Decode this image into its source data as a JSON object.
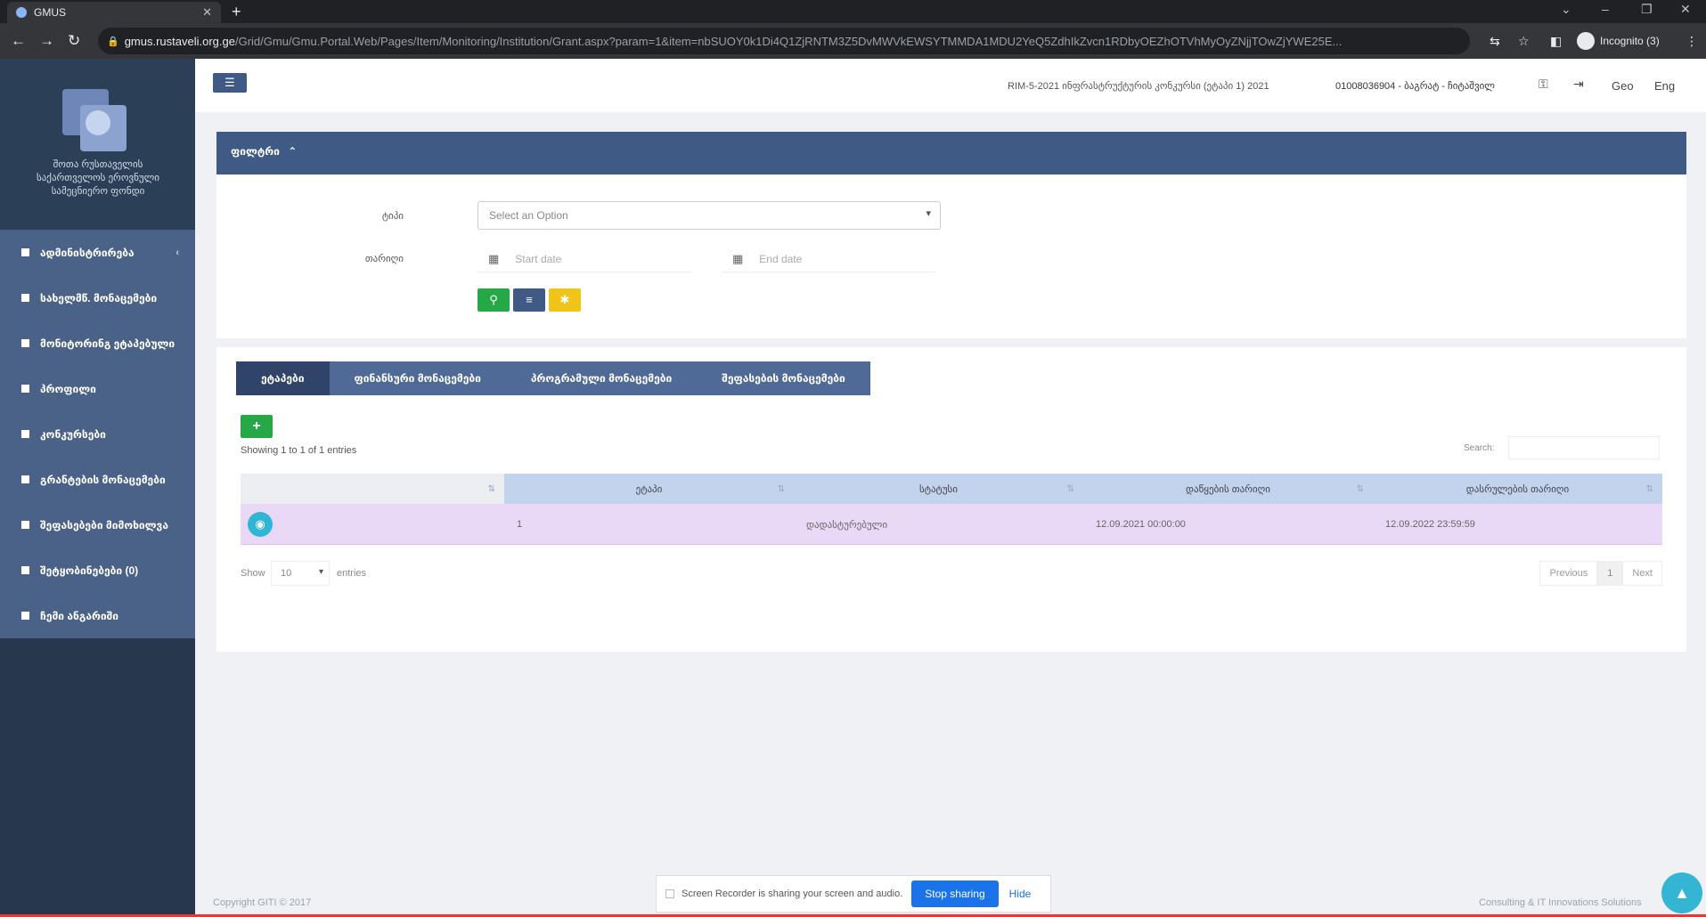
{
  "browser": {
    "tab_title": "GMUS",
    "tab_close": "✕",
    "new_tab": "+",
    "url_host": "gmus.rustaveli.org.ge",
    "url_path": "/Grid/Gmu/Gmu.Portal.Web/Pages/Item/Monitoring/Institution/Grant.aspx?param=1&item=nbSUOY0k1Di4Q1ZjRNTM3Z5DvMWVkEWSYTMMDA1MDU2YeQ5ZdhIkZvcn1RDbyOEZhOTVhMyOyZNjjTOwZjYWE25E...",
    "incognito": "Incognito (3)"
  },
  "sidebar": {
    "logo_text": "შოთა რუსთაველის საქართველოს ეროვნული სამეცნიერო ფონდი",
    "items": [
      {
        "label": "ადმინისტრირება",
        "arrow": "‹"
      },
      {
        "label": "სახელმწ. მონაცემები"
      },
      {
        "label": "მონიტორინგ ეტაპებული"
      },
      {
        "label": "პროფილი"
      },
      {
        "label": "კონკურსები"
      },
      {
        "label": "გრანტების მონაცემები"
      },
      {
        "label": "შეფასებები მიმოხილვა"
      },
      {
        "label": "შეტყობინებები (0)"
      },
      {
        "label": "ჩემი ანგარიში"
      }
    ]
  },
  "topbar": {
    "menu_icon": "☰",
    "project_info": "RIM-5-2021 ინფრასტრუქტურის კონკურსი (ეტაპი 1) 2021",
    "user_info": "01008036904 - ბაგრატ - ჩიტაშვილ",
    "lang_geo": "Geo",
    "lang_eng": "Eng"
  },
  "filter": {
    "header": "ფილტრი",
    "toggle": "⌃",
    "label_type": "ტიპი",
    "label_date": "თარიღი",
    "select_placeholder": "Select an Option",
    "start_placeholder": "Start date",
    "end_placeholder": "End date",
    "btn_search": "⚲",
    "btn_list": "≡",
    "btn_clear": "✱"
  },
  "results": {
    "tabs": [
      "ეტაპები",
      "ფინანსური მონაცემები",
      "პროგრამული მონაცემები",
      "შეფასების მონაცემები"
    ],
    "add": "+",
    "showing": "Showing 1 to 1 of 1 entries",
    "search_label": "Search:",
    "columns": [
      "ეტაპი",
      "სტატუსი",
      "დაწყების თარიღი",
      "დასრულების თარიღი"
    ],
    "rows": [
      {
        "stage": "1",
        "status": "დადასტურებული",
        "start": "12.09.2021 00:00:00",
        "end": "12.09.2022 23:59:59"
      }
    ],
    "show_label": "Show",
    "page_length": "10",
    "entries_label": "entries",
    "prev": "Previous",
    "page": "1",
    "next": "Next"
  },
  "footer": {
    "copyright": "Copyright GITI © 2017",
    "right": "Consulting & IT Innovations   Solutions",
    "share_text": "Screen Recorder is sharing your screen and audio.",
    "stop_sharing": "Stop sharing",
    "hide": "Hide",
    "scroll_top": "▲"
  }
}
